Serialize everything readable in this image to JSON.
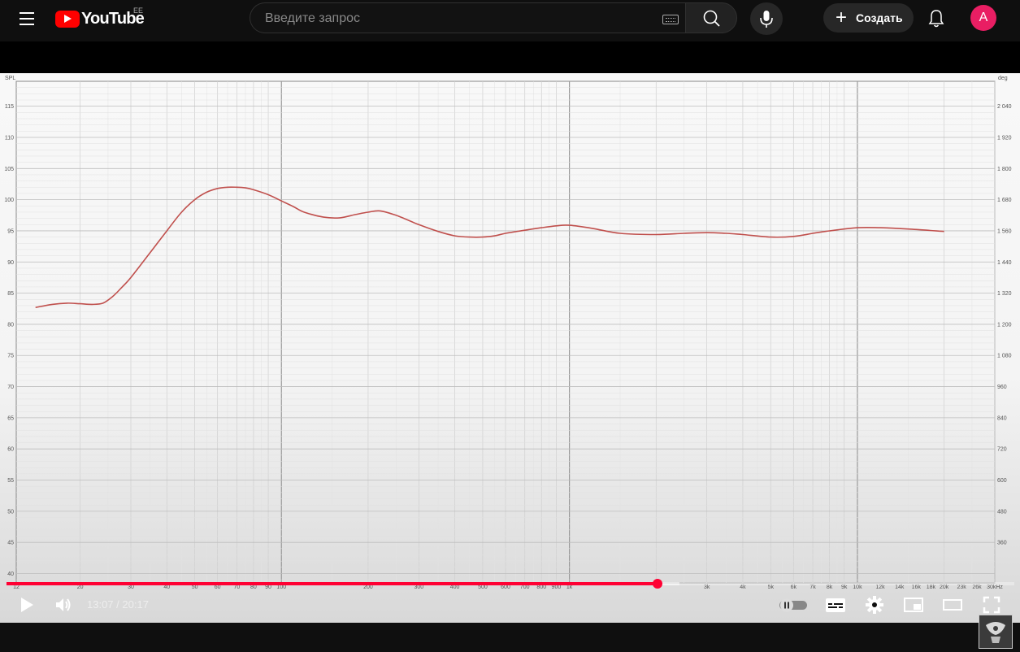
{
  "header": {
    "logo_text": "YouTube",
    "country_code": "EE",
    "search_placeholder": "Введите запрос",
    "create_label": "Создать",
    "avatar_letter": "A"
  },
  "player": {
    "current_time": "13:07",
    "separator": " / ",
    "duration": "20:17",
    "progress_fraction": 0.646,
    "buffered_fraction": 0.668
  },
  "colors": {
    "brand_red": "#ff0000",
    "progress_red": "#ff0033",
    "avatar": "#e91e63",
    "curve": "#c0504d"
  },
  "chart_data": {
    "type": "line",
    "xscale": "log",
    "xlabel": "",
    "ylabel": "SPL",
    "y2label": "deg",
    "xlim": [
      12,
      30000
    ],
    "ylim": [
      38.5,
      119
    ],
    "y_ticks": [
      115,
      110,
      105,
      100,
      95,
      90,
      85,
      80,
      75,
      70,
      65,
      60,
      55,
      50,
      45,
      40
    ],
    "y2_ticks": [
      "2 040",
      "1 920",
      "1 800",
      "1 680",
      "1 560",
      "1 440",
      "1 320",
      "1 200",
      "1 080",
      "960",
      "840",
      "720",
      "600",
      "480",
      "360"
    ],
    "x_ticks": [
      {
        "v": 12,
        "label": "12"
      },
      {
        "v": 20,
        "label": "20"
      },
      {
        "v": 30,
        "label": "30"
      },
      {
        "v": 40,
        "label": "40"
      },
      {
        "v": 50,
        "label": "50"
      },
      {
        "v": 60,
        "label": "60"
      },
      {
        "v": 70,
        "label": "70"
      },
      {
        "v": 80,
        "label": "80"
      },
      {
        "v": 90,
        "label": "90"
      },
      {
        "v": 100,
        "label": "100"
      },
      {
        "v": 200,
        "label": "200"
      },
      {
        "v": 300,
        "label": "300"
      },
      {
        "v": 400,
        "label": "400"
      },
      {
        "v": 500,
        "label": "500"
      },
      {
        "v": 600,
        "label": "600"
      },
      {
        "v": 700,
        "label": "700"
      },
      {
        "v": 800,
        "label": "800"
      },
      {
        "v": 900,
        "label": "900"
      },
      {
        "v": 1000,
        "label": "1k"
      },
      {
        "v": 3000,
        "label": "3k"
      },
      {
        "v": 4000,
        "label": "4k"
      },
      {
        "v": 5000,
        "label": "5k"
      },
      {
        "v": 6000,
        "label": "6k"
      },
      {
        "v": 7000,
        "label": "7k"
      },
      {
        "v": 8000,
        "label": "8k"
      },
      {
        "v": 9000,
        "label": "9k"
      },
      {
        "v": 10000,
        "label": "10k"
      },
      {
        "v": 12000,
        "label": "12k"
      },
      {
        "v": 14000,
        "label": "14k"
      },
      {
        "v": 16000,
        "label": "16k"
      },
      {
        "v": 18000,
        "label": "18k"
      },
      {
        "v": 20000,
        "label": "20k"
      },
      {
        "v": 23000,
        "label": "23k"
      },
      {
        "v": 26000,
        "label": "26k"
      },
      {
        "v": 30000,
        "label": "30kHz"
      }
    ],
    "series": [
      {
        "x": [
          14,
          16,
          18,
          20,
          22,
          24,
          26,
          28,
          30,
          35,
          40,
          45,
          50,
          55,
          60,
          65,
          70,
          75,
          80,
          90,
          100,
          110,
          120,
          140,
          160,
          180,
          200,
          220,
          250,
          300,
          350,
          400,
          450,
          500,
          550,
          600,
          700,
          800,
          900,
          1000,
          1200,
          1500,
          2000,
          2500,
          3000,
          3500,
          4000,
          5000,
          6000,
          7000,
          8000,
          10000,
          12000,
          15000,
          20000
        ],
        "y": [
          82.7,
          83.2,
          83.4,
          83.3,
          83.2,
          83.4,
          84.5,
          86.0,
          87.5,
          91.5,
          95.0,
          98.0,
          100.0,
          101.2,
          101.8,
          102.0,
          102.0,
          101.9,
          101.6,
          100.8,
          99.8,
          98.9,
          98.0,
          97.2,
          97.1,
          97.6,
          98.0,
          98.2,
          97.5,
          96.0,
          94.9,
          94.2,
          94.0,
          94.0,
          94.2,
          94.6,
          95.1,
          95.5,
          95.8,
          95.9,
          95.4,
          94.6,
          94.4,
          94.6,
          94.7,
          94.6,
          94.4,
          94.0,
          94.1,
          94.6,
          95.0,
          95.5,
          95.5,
          95.3,
          94.9
        ]
      }
    ]
  }
}
